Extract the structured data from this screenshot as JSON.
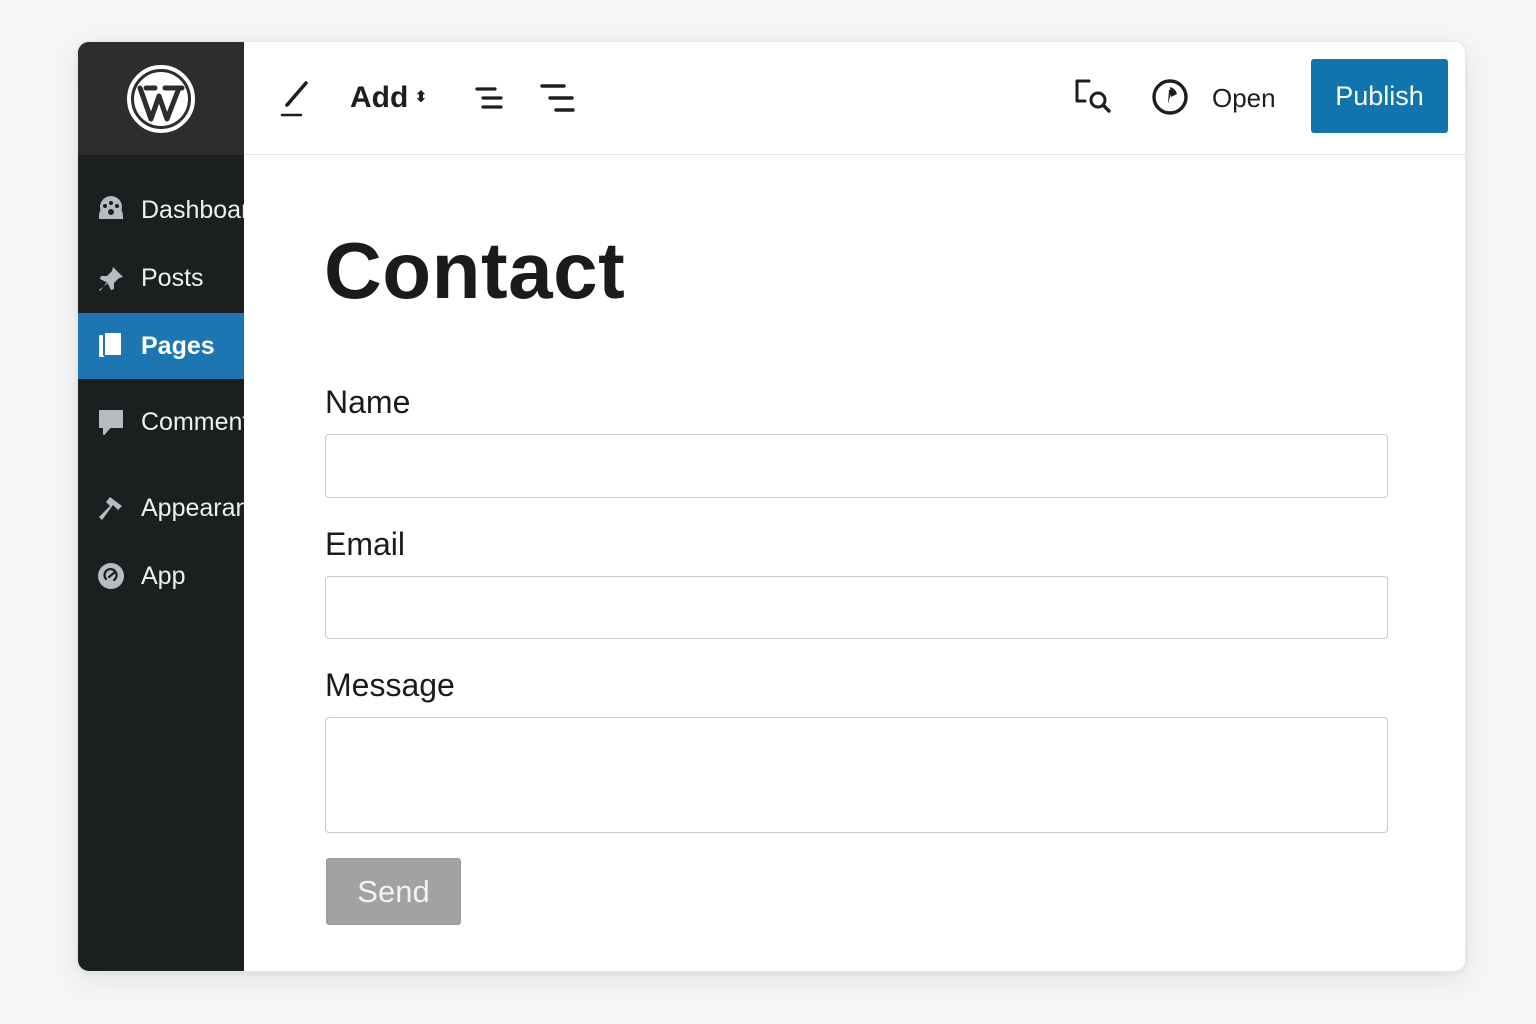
{
  "sidebar": {
    "logo": "wordpress-logo",
    "items": [
      {
        "label": "Dashboard",
        "icon": "dashboard-icon",
        "active": false
      },
      {
        "label": "Posts",
        "icon": "pushpin-icon",
        "active": false
      },
      {
        "label": "Pages",
        "icon": "pages-icon",
        "active": true
      },
      {
        "label": "Comments",
        "icon": "comment-icon",
        "active": false
      },
      {
        "label": "Appearance",
        "icon": "hammer-icon",
        "active": false
      },
      {
        "label": "App",
        "icon": "app-icon",
        "active": false
      }
    ]
  },
  "toolbar": {
    "edit_icon": "pencil-icon",
    "add_label": "Add",
    "add_arrows": "⬍",
    "outline_icon": "outline-list-icon",
    "list_view_icon": "list-view-icon",
    "preview_icon": "preview-search-icon",
    "history_icon": "circle-badge-icon",
    "open_label": "Open",
    "publish_label": "Publish"
  },
  "page": {
    "title": "Contact",
    "fields": [
      {
        "label": "Name",
        "value": "",
        "placeholder": ""
      },
      {
        "label": "Email",
        "value": "",
        "placeholder": ""
      },
      {
        "label": "Message",
        "value": "",
        "placeholder": ""
      }
    ],
    "send_label": "Send"
  },
  "colors": {
    "sidebar_bg": "#1b1f20",
    "logo_bg": "#2b2d2f",
    "active_item": "#1d75b2",
    "publish_button": "#1174ad",
    "send_button": "#a2a2a2"
  }
}
